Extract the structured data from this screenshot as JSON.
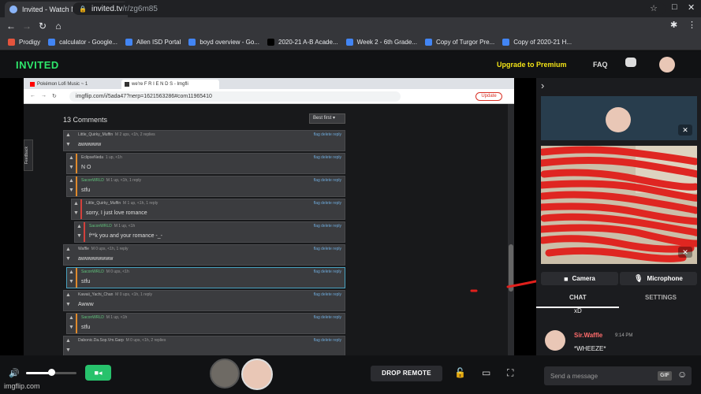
{
  "browser": {
    "tab_title": "Invited - Watch Movies and ...",
    "url_host": "invited.tv",
    "url_path": "/r/zg6m85",
    "bookmarks": [
      {
        "label": "Prodigy",
        "color": "#e4543d"
      },
      {
        "label": "calculator - Google...",
        "color": "#4285f4"
      },
      {
        "label": "Allen ISD Portal",
        "color": "#4285f4"
      },
      {
        "label": "boyd overview - Go...",
        "color": "#4285f4"
      },
      {
        "label": "2020-21 A-B Acade...",
        "color": "#000000"
      },
      {
        "label": "Week 2 - 6th Grade...",
        "color": "#4285f4"
      },
      {
        "label": "Copy of Turgor Pre...",
        "color": "#4285f4"
      },
      {
        "label": "Copy of 2020-21 H...",
        "color": "#4285f4"
      }
    ]
  },
  "app": {
    "logo": "INVITED",
    "upgrade": "Upgrade to Premium",
    "faq": "FAQ",
    "accent": "#2ee66b"
  },
  "shared_screen": {
    "tab1": "Pokémon Lofi Music ~ 1",
    "tab2": "we're F R I E N D S - Imgfli",
    "url": "imgflip.com/i/5ada47?nerp=1621563286#com11965410",
    "update_label": "Update",
    "feedback_label": "Feedback",
    "comments_title": "13 Comments",
    "sort_label": "Best first",
    "comments": [
      {
        "user": "Little_Quirky_Muffin",
        "meta": "M   2 ups, <1h, 2 replies",
        "body": "awwwww",
        "actions": "flag  delete  reply"
      },
      {
        "user": "EclipseNeda",
        "meta": "1 up, <1h",
        "body": "N O",
        "actions": "flag  delete  reply"
      },
      {
        "user": "SaconWRLD",
        "meta": "M   1 up, <1h, 1 reply",
        "body": "stfu",
        "actions": "flag  delete  reply"
      },
      {
        "user": "Little_Quirky_Muffin",
        "meta": "M   1 up, <1h, 1 reply",
        "body": "sorry, I just love romance",
        "actions": "flag  delete  reply"
      },
      {
        "user": "SaconWRLD",
        "meta": "M   1 up, <1h",
        "body": "f**k you and your romance -_-",
        "actions": "flag  delete  reply"
      },
      {
        "user": "Waffle",
        "meta": "M   0 ups, <1h, 1 reply",
        "body": "awwwwwwww",
        "actions": "flag  delete  reply"
      },
      {
        "user": "SaconWRLD",
        "meta": "M   0 ups, <1h",
        "body": "stfu",
        "actions": "flag  delete  reply"
      },
      {
        "user": "Kawaii_Yachi_Chan",
        "meta": "M   0 ups, <1h, 1 reply",
        "body": "Awww",
        "actions": "flag  delete  reply"
      },
      {
        "user": "SaconWRLD",
        "meta": "M   1 up, <1h",
        "body": "stfu",
        "actions": "flag  delete  reply"
      },
      {
        "user": "Dabonic.Da.Sop.Vm.Garp",
        "meta": "M   0 ups, <1h, 2 replies",
        "body": "",
        "actions": "flag  delete  reply"
      }
    ]
  },
  "panel": {
    "camera_label": "Camera",
    "microphone_label": "Microphone",
    "chat_tab": "CHAT",
    "settings_tab": "SETTINGS",
    "prev_message": "xD",
    "message": {
      "name": "Sir.Waffle",
      "time": "9:14 PM",
      "text": "*WHEEZE*"
    }
  },
  "controls": {
    "volume_level": 0.5,
    "drop_remote": "DROP REMOTE",
    "chat_placeholder": "Send a message",
    "gif_label": "GIF"
  },
  "watermark": "imgflip.com"
}
